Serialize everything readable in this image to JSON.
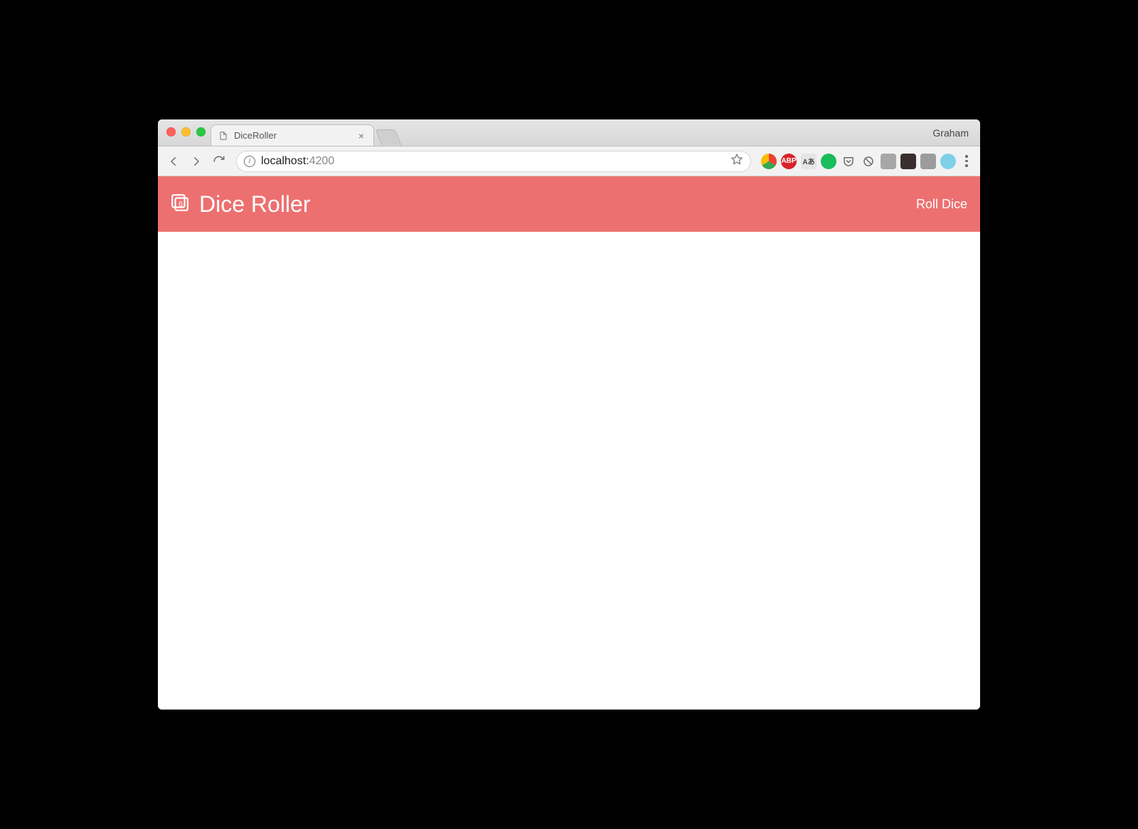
{
  "browser": {
    "tab_title": "DiceRoller",
    "profile_name": "Graham",
    "url_host": "localhost:",
    "url_port": "4200"
  },
  "app": {
    "title": "Dice Roller",
    "nav_roll": "Roll Dice"
  },
  "extensions": [
    {
      "name": "ext-chrome-colorful",
      "bg": "conic-gradient(#ea4335 0 120deg,#34a853 120deg 240deg,#fbbc05 240deg 360deg)",
      "label": ""
    },
    {
      "name": "ext-adblock",
      "bg": "#d8232a",
      "label": "ABP",
      "shape": "circle"
    },
    {
      "name": "ext-translate",
      "bg": "#e5e5e5",
      "label": "Aあ",
      "color": "#444",
      "shape": "square"
    },
    {
      "name": "ext-green",
      "bg": "#1abc5b",
      "label": "",
      "shape": "circle"
    },
    {
      "name": "ext-pocket",
      "bg": "transparent",
      "label": "",
      "shape": "plain"
    },
    {
      "name": "ext-sync",
      "bg": "transparent",
      "label": "",
      "shape": "plain"
    },
    {
      "name": "ext-greybox",
      "bg": "#a7a7a7",
      "label": "",
      "shape": "square"
    },
    {
      "name": "ext-mask",
      "bg": "#3a2f2f",
      "label": "",
      "shape": "square"
    },
    {
      "name": "ext-md",
      "bg": "#9c9c9c",
      "label": "",
      "shape": "square"
    },
    {
      "name": "ext-snowflake",
      "bg": "#7ed0e8",
      "label": "",
      "shape": "circle"
    }
  ]
}
